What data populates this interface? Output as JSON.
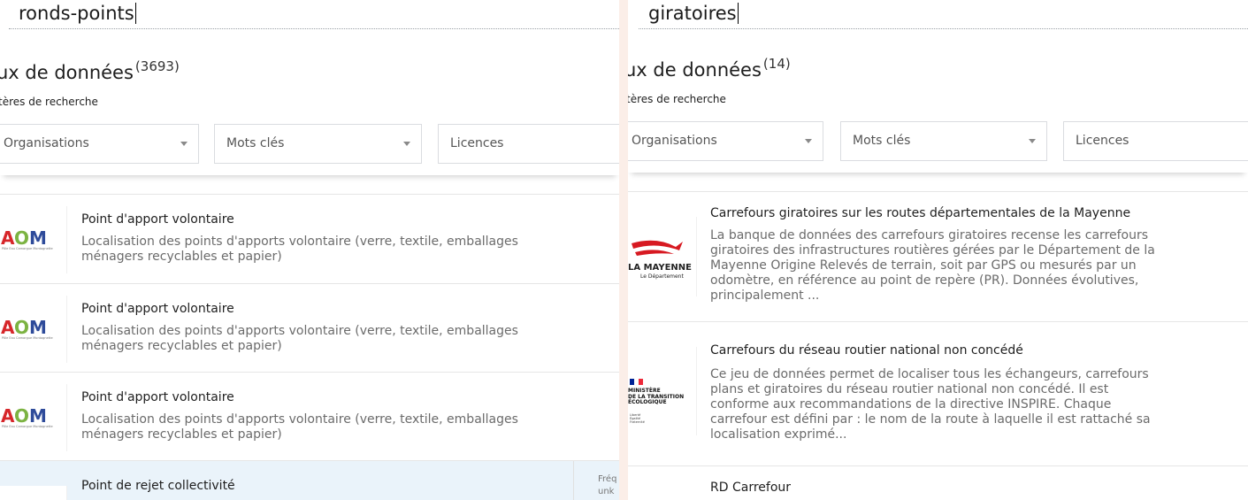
{
  "colors": {
    "background": "#fbeee8",
    "panel": "#ffffff",
    "highlight_row": "#eaf3fa",
    "aom_red": "#d6262a",
    "aom_green": "#7cb342",
    "aom_blue": "#2e4b9a",
    "mayenne_red": "#d71921"
  },
  "left": {
    "search_value": "ronds-points",
    "dataset_title": "ux de données",
    "dataset_count": "3693",
    "criteria_label": "tères de recherche",
    "filters": {
      "organisations": "Organisations",
      "keywords": "Mots clés",
      "licences": "Licences"
    },
    "results": [
      {
        "title": "Point d'apport volontaire",
        "description": "Localisation des points d'apports volontaire (verre, textile, emballages ménagers recyclables et papier)",
        "logo": "AOM",
        "logo_sub": "Pôle Eau Camargue Montagnette"
      },
      {
        "title": "Point d'apport volontaire",
        "description": "Localisation des points d'apports volontaire (verre, textile, emballages ménagers recyclables et papier)",
        "logo": "AOM",
        "logo_sub": "Pôle Eau Camargue Montagnette"
      },
      {
        "title": "Point d'apport volontaire",
        "description": "Localisation des points d'apports volontaire (verre, textile, emballages ménagers recyclables et papier)",
        "logo": "AOM",
        "logo_sub": "Pôle Eau Camargue Montagnette"
      },
      {
        "title": "Point de rejet collectivité",
        "description": "",
        "frequency_label": "Fréq",
        "frequency_value": "unk"
      }
    ]
  },
  "right": {
    "search_value": "giratoires",
    "dataset_title": "ux de données",
    "dataset_count": "14",
    "criteria_label": "tères de recherche",
    "filters": {
      "organisations": "Organisations",
      "keywords": "Mots clés",
      "licences": "Licences"
    },
    "results": [
      {
        "title": "Carrefours giratoires sur les routes départementales de la Mayenne",
        "description": "La banque de données des carrefours giratoires recense les carrefours giratoires des infrastructures routières gérées par le Département de la Mayenne Origine Relevés de terrain, soit par GPS ou mesurés par un odomètre, en référence au point de repère (PR). Données évolutives, principalement ...",
        "logo_name": "LA MAYENNE",
        "logo_sub": "Le Département"
      },
      {
        "title": "Carrefours du réseau routier national non concédé",
        "description": "Ce jeu de données permet de localiser tous les échangeurs, carrefours plans et giratoires du réseau routier national non concédé. Il est conforme aux recommandations de la directive INSPIRE. Chaque carrefour est défini par : le nom de la route à laquelle il est rattaché sa localisation exprimé...",
        "logo_name": "MINISTÈRE\nDE LA TRANSITION\nÉCOLOGIQUE",
        "logo_motto": "Liberté\nÉgalité\nFraternité"
      },
      {
        "title": "RD Carrefour",
        "description": ""
      }
    ]
  }
}
